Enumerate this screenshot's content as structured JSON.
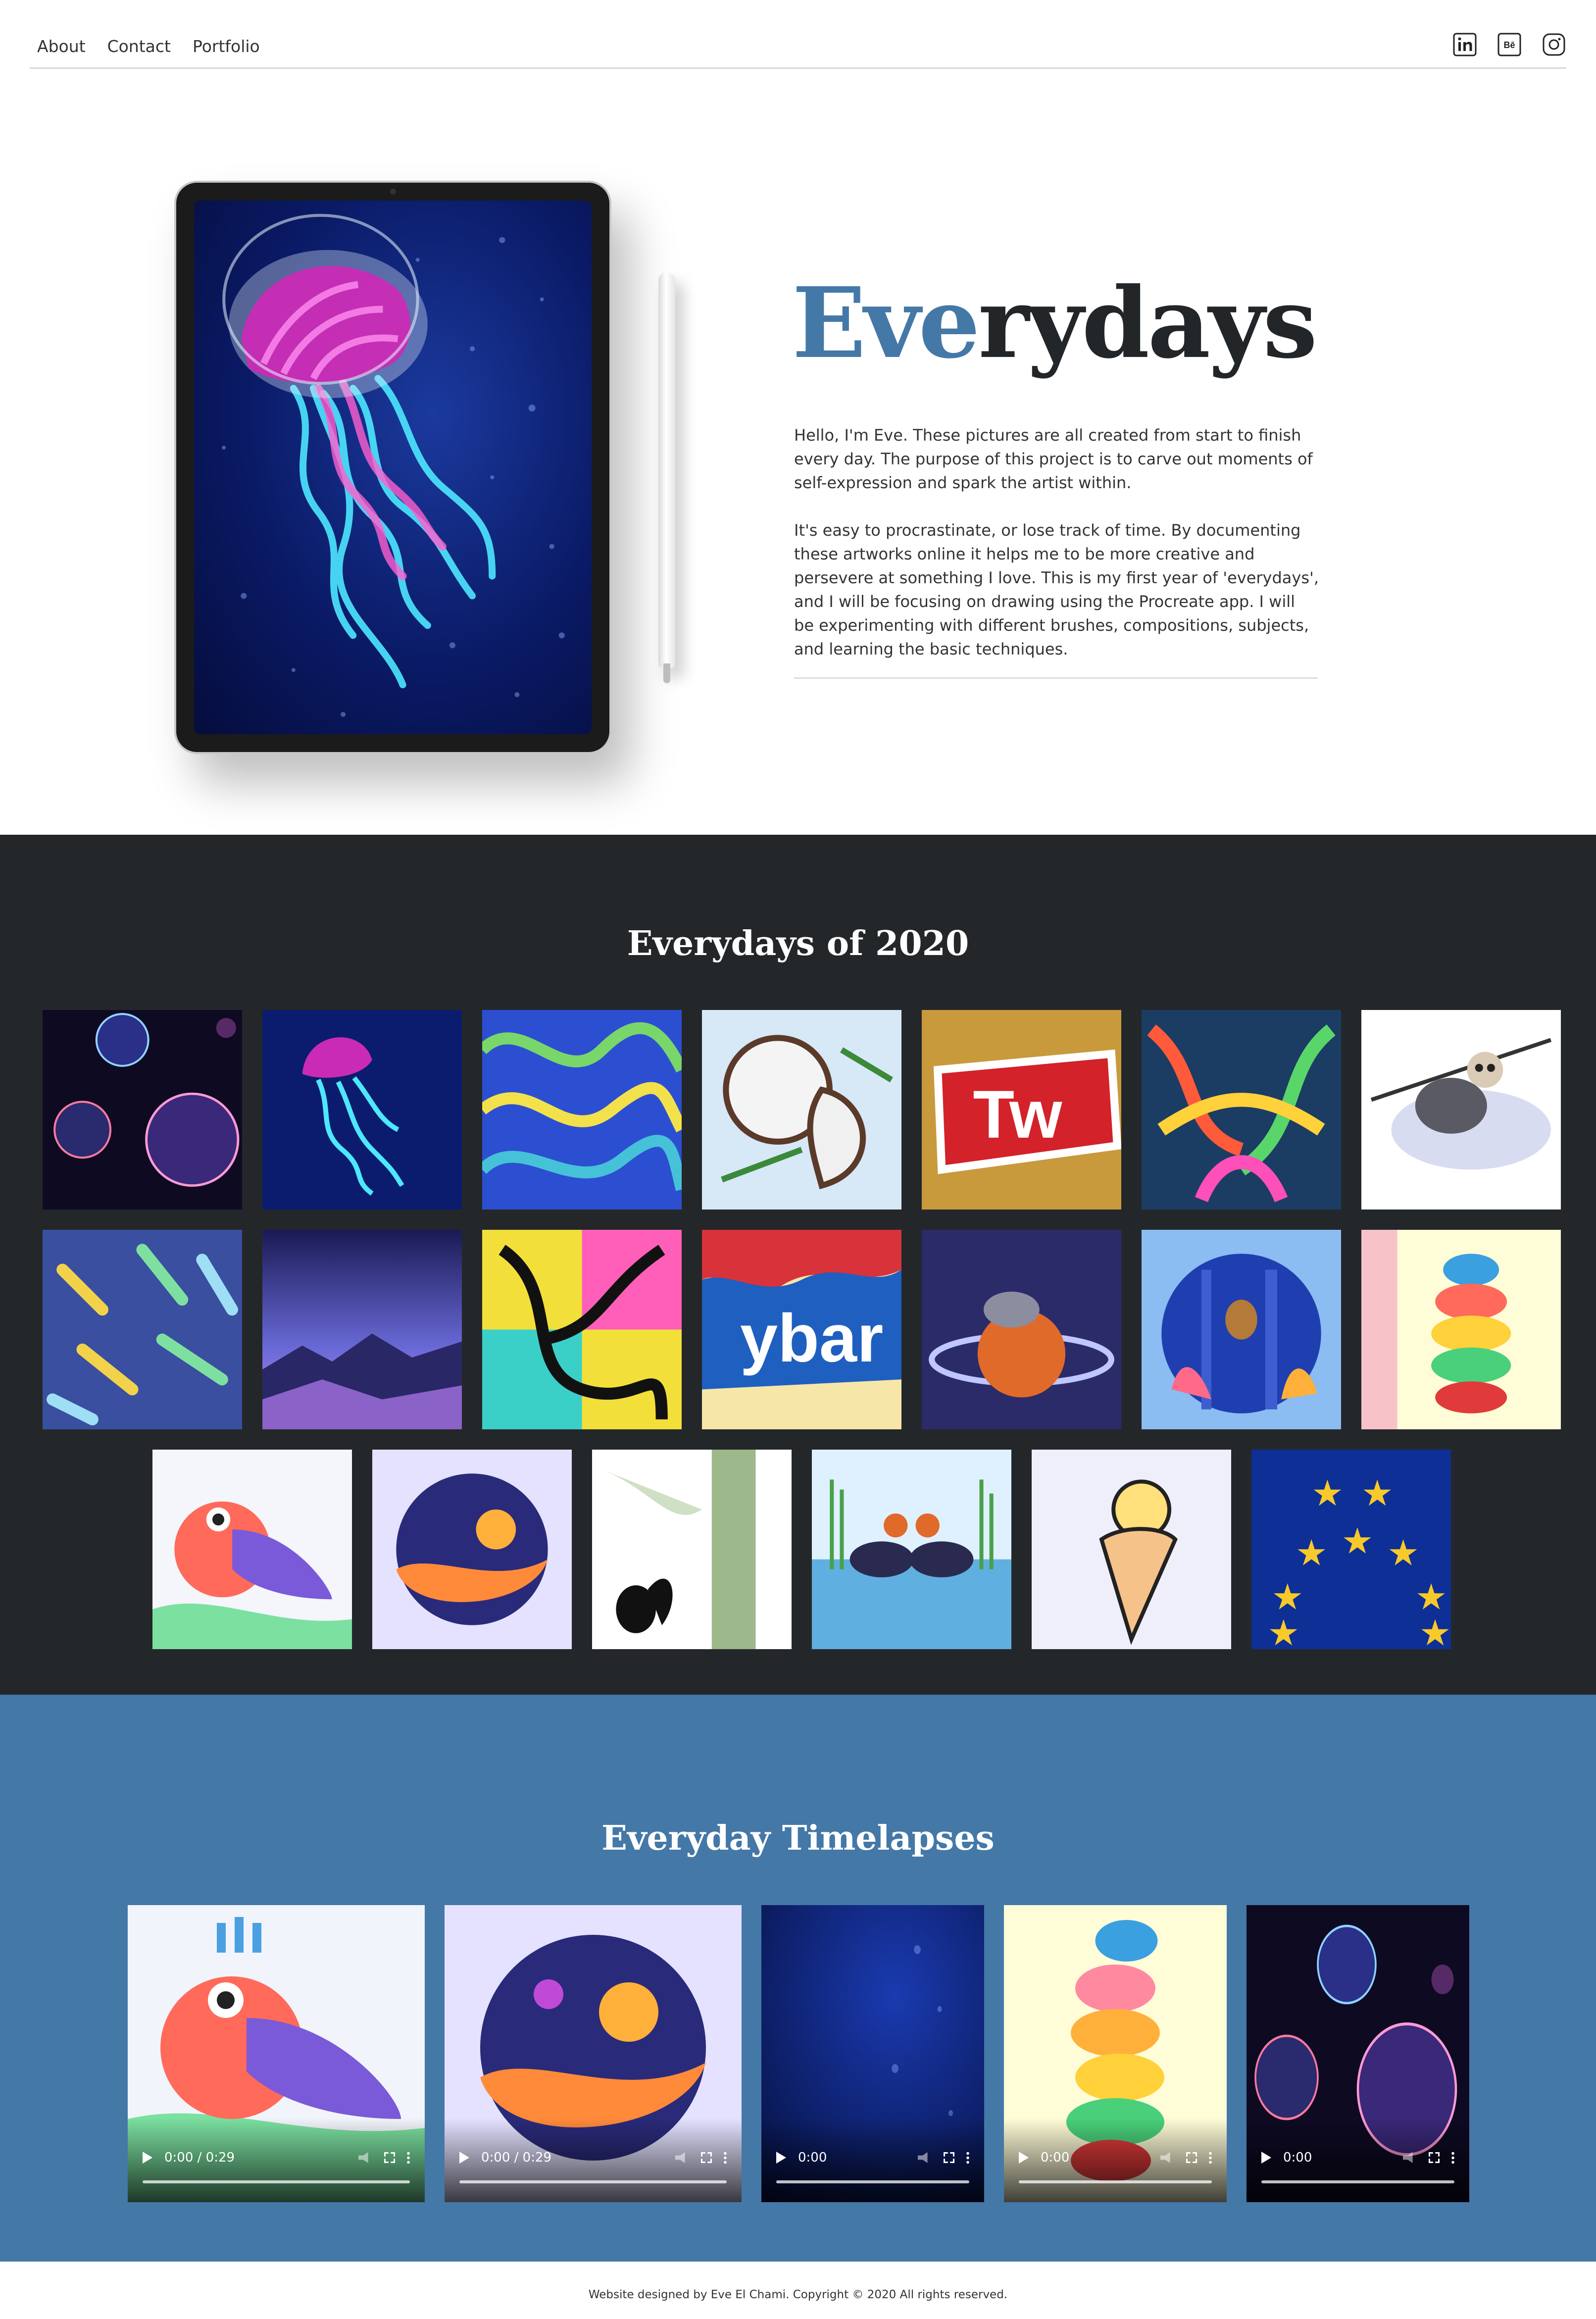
{
  "nav": {
    "links": [
      "About",
      "Contact",
      "Portfolio"
    ],
    "icons": [
      "linkedin-icon",
      "behance-icon",
      "instagram-icon"
    ]
  },
  "hero": {
    "title_highlight": "Eve",
    "title_rest": "rydays",
    "paragraphs": [
      "Hello, I'm Eve. These pictures are all created from start to finish every day. The purpose of this project is to carve out moments of self-expression and spark the artist within.",
      "It's easy to procrastinate, or lose track of time. By documenting these artworks online it helps me to be more creative and persevere at something I love. This is my first year of 'everydays', and I will be focusing on drawing using the Procreate app. I will be experimenting with different brushes, compositions, subjects, and learning the basic techniques."
    ]
  },
  "gallery": {
    "title": "Everydays of 2020",
    "tile_count": 20
  },
  "timelapses": {
    "title": "Everyday Timelapses",
    "videos": [
      {
        "time": "0:00 / 0:29"
      },
      {
        "time": "0:00 / 0:29"
      },
      {
        "time": "0:00"
      },
      {
        "time": "0:00"
      },
      {
        "time": "0:00"
      }
    ]
  },
  "footer": {
    "text": "Website designed by Eve El Chami. Copyright © 2020 All rights reserved."
  },
  "colors": {
    "accent": "#4478a7",
    "dark": "#24272a"
  }
}
